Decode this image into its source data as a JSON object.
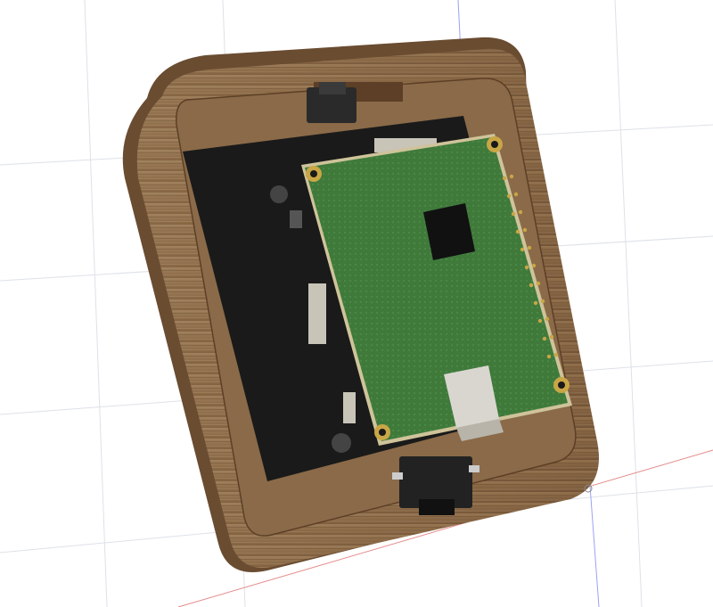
{
  "scene": {
    "subject": "wood-frame-enclosure-with-green-pcb",
    "view": "3d-cad-viewport",
    "colors": {
      "background": "#ffffff",
      "grid": "#dde1e8",
      "axis_red": "#e58a8a",
      "axis_blue": "#9aa3f0",
      "wood_light": "#a0825f",
      "wood_dark": "#6a4c31",
      "screen": "#1a1a1a",
      "pcb": "#3f7a3b",
      "pcb_edge": "#cfc39a",
      "gold": "#c9a646",
      "connector": "#d9d6cf",
      "chip": "#111111"
    },
    "icons": [
      "mounting-hole-icon",
      "header-pin-icon",
      "usb-connector-icon",
      "button-icon"
    ]
  }
}
